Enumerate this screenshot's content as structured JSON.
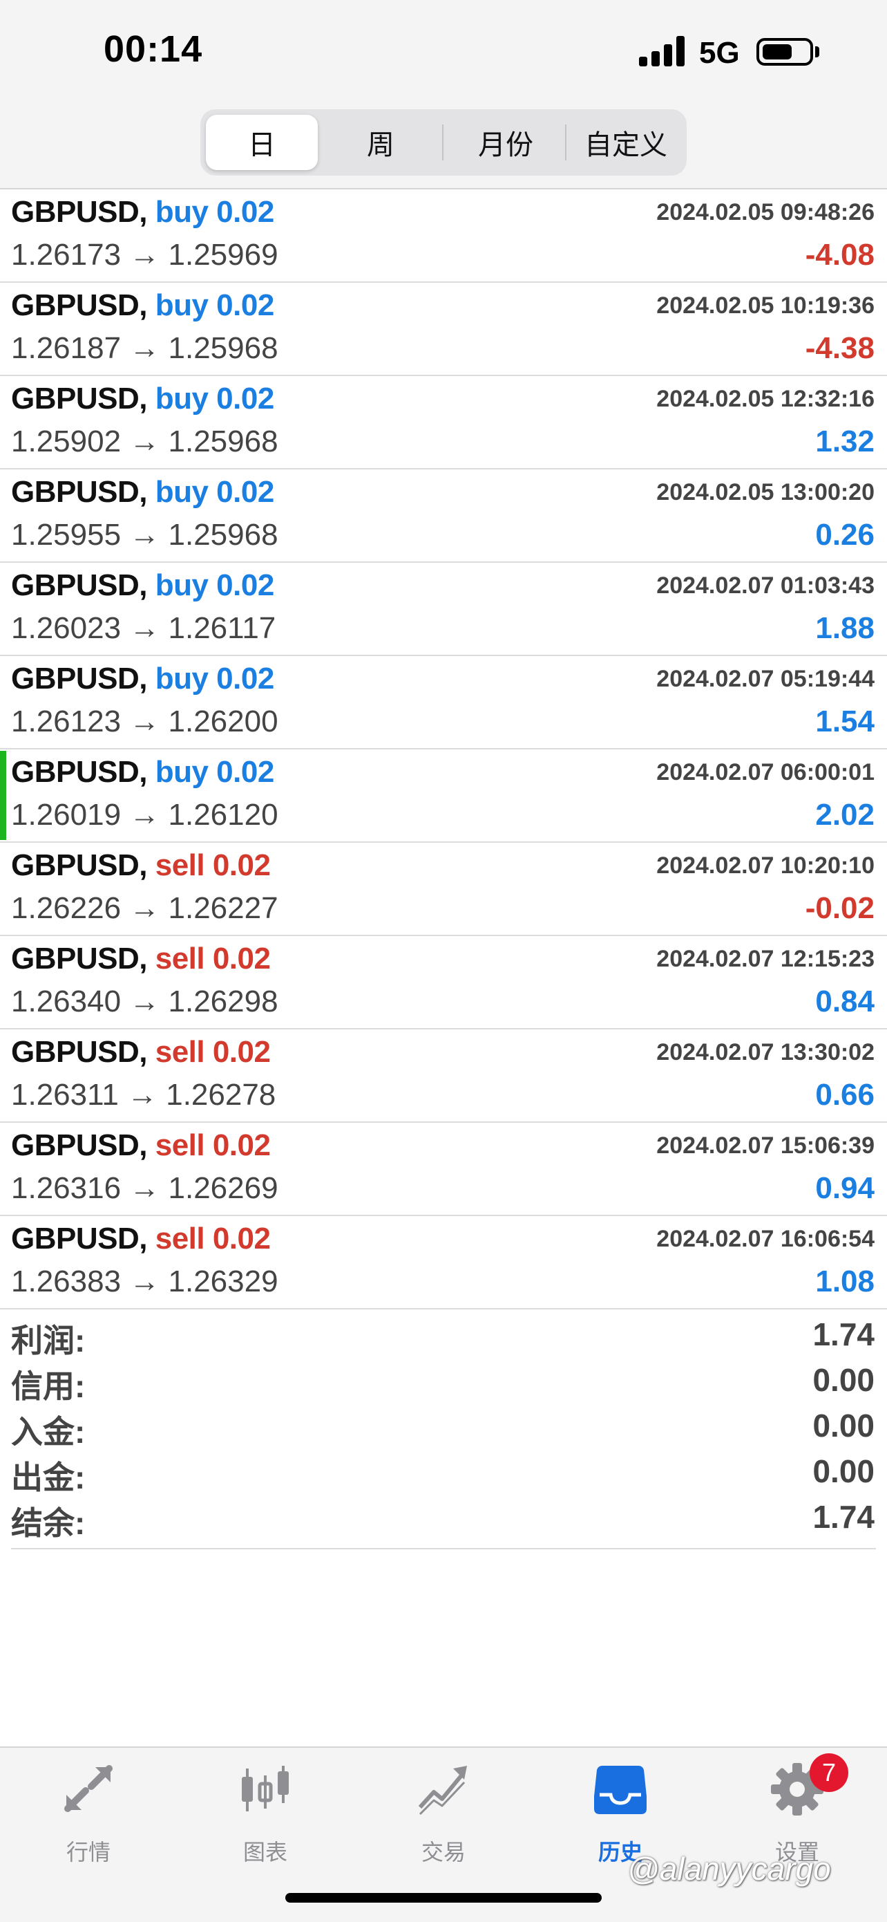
{
  "status": {
    "time": "00:14",
    "network": "5G",
    "battery_level": 0.65
  },
  "tabs_period": [
    {
      "label": "日",
      "active": true
    },
    {
      "label": "周",
      "active": false
    },
    {
      "label": "月份",
      "active": false
    },
    {
      "label": "自定义",
      "active": false
    }
  ],
  "deals": [
    {
      "symbol": "GBPUSD,",
      "side": "buy",
      "volume_text": "buy 0.02",
      "time": "2024.02.05 09:48:26",
      "prices": "1.26173 → 1.25969",
      "profit": "-4.08",
      "selected": false
    },
    {
      "symbol": "GBPUSD,",
      "side": "buy",
      "volume_text": "buy 0.02",
      "time": "2024.02.05 10:19:36",
      "prices": "1.26187 → 1.25968",
      "profit": "-4.38",
      "selected": false
    },
    {
      "symbol": "GBPUSD,",
      "side": "buy",
      "volume_text": "buy 0.02",
      "time": "2024.02.05 12:32:16",
      "prices": "1.25902 → 1.25968",
      "profit": "1.32",
      "selected": false
    },
    {
      "symbol": "GBPUSD,",
      "side": "buy",
      "volume_text": "buy 0.02",
      "time": "2024.02.05 13:00:20",
      "prices": "1.25955 → 1.25968",
      "profit": "0.26",
      "selected": false
    },
    {
      "symbol": "GBPUSD,",
      "side": "buy",
      "volume_text": "buy 0.02",
      "time": "2024.02.07 01:03:43",
      "prices": "1.26023 → 1.26117",
      "profit": "1.88",
      "selected": false
    },
    {
      "symbol": "GBPUSD,",
      "side": "buy",
      "volume_text": "buy 0.02",
      "time": "2024.02.07 05:19:44",
      "prices": "1.26123 → 1.26200",
      "profit": "1.54",
      "selected": false
    },
    {
      "symbol": "GBPUSD,",
      "side": "buy",
      "volume_text": "buy 0.02",
      "time": "2024.02.07 06:00:01",
      "prices": "1.26019 → 1.26120",
      "profit": "2.02",
      "selected": true
    },
    {
      "symbol": "GBPUSD,",
      "side": "sell",
      "volume_text": "sell 0.02",
      "time": "2024.02.07 10:20:10",
      "prices": "1.26226 → 1.26227",
      "profit": "-0.02",
      "selected": false
    },
    {
      "symbol": "GBPUSD,",
      "side": "sell",
      "volume_text": "sell 0.02",
      "time": "2024.02.07 12:15:23",
      "prices": "1.26340 → 1.26298",
      "profit": "0.84",
      "selected": false
    },
    {
      "symbol": "GBPUSD,",
      "side": "sell",
      "volume_text": "sell 0.02",
      "time": "2024.02.07 13:30:02",
      "prices": "1.26311 → 1.26278",
      "profit": "0.66",
      "selected": false
    },
    {
      "symbol": "GBPUSD,",
      "side": "sell",
      "volume_text": "sell 0.02",
      "time": "2024.02.07 15:06:39",
      "prices": "1.26316 → 1.26269",
      "profit": "0.94",
      "selected": false
    },
    {
      "symbol": "GBPUSD,",
      "side": "sell",
      "volume_text": "sell 0.02",
      "time": "2024.02.07 16:06:54",
      "prices": "1.26383 → 1.26329",
      "profit": "1.08",
      "selected": false
    }
  ],
  "summary": [
    {
      "label": "利润:",
      "value": "1.74"
    },
    {
      "label": "信用:",
      "value": "0.00"
    },
    {
      "label": "入金:",
      "value": "0.00"
    },
    {
      "label": "出金:",
      "value": "0.00"
    },
    {
      "label": "结余:",
      "value": "1.74"
    }
  ],
  "tabbar": [
    {
      "label": "行情",
      "icon": "quotes-arrows-icon",
      "active": false
    },
    {
      "label": "图表",
      "icon": "candlestick-chart-icon",
      "active": false
    },
    {
      "label": "交易",
      "icon": "trade-line-icon",
      "active": false
    },
    {
      "label": "历史",
      "icon": "history-inbox-icon",
      "active": true
    },
    {
      "label": "设置",
      "icon": "settings-gear-icon",
      "active": false
    }
  ],
  "settings_badge": "7",
  "watermark": "@alanyycargo",
  "colors": {
    "buy": "#1a7fe0",
    "sell": "#d23a2d",
    "positive": "#1a7fe0",
    "negative": "#d23a2d",
    "selected_marker": "#1db51d",
    "active_tab": "#1a6fe0",
    "badge": "#e3182f"
  }
}
